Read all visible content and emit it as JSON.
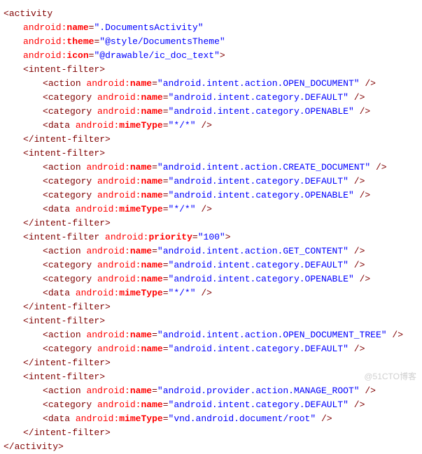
{
  "activity": {
    "name": ".DocumentsActivity",
    "theme": "@style/DocumentsTheme",
    "icon": "@drawable/ic_doc_text"
  },
  "filters": [
    {
      "priority": null,
      "actions": [
        "android.intent.action.OPEN_DOCUMENT"
      ],
      "categories": [
        "android.intent.category.DEFAULT",
        "android.intent.category.OPENABLE"
      ],
      "mimeType": "*/*"
    },
    {
      "priority": null,
      "actions": [
        "android.intent.action.CREATE_DOCUMENT"
      ],
      "categories": [
        "android.intent.category.DEFAULT",
        "android.intent.category.OPENABLE"
      ],
      "mimeType": "*/*"
    },
    {
      "priority": "100",
      "actions": [
        "android.intent.action.GET_CONTENT"
      ],
      "categories": [
        "android.intent.category.DEFAULT",
        "android.intent.category.OPENABLE"
      ],
      "mimeType": "*/*"
    },
    {
      "priority": null,
      "actions": [
        "android.intent.action.OPEN_DOCUMENT_TREE"
      ],
      "categories": [
        "android.intent.category.DEFAULT"
      ],
      "mimeType": null
    },
    {
      "priority": null,
      "actions": [
        "android.provider.action.MANAGE_ROOT"
      ],
      "categories": [
        "android.intent.category.DEFAULT"
      ],
      "mimeType": "vnd.android.document/root"
    }
  ],
  "tokens": {
    "activity_open": "activity",
    "activity_close": "activity",
    "intent_filter": "intent-filter",
    "action": "action",
    "category": "category",
    "data": "data",
    "attr_name": "name",
    "attr_theme": "theme",
    "attr_icon": "icon",
    "attr_mime": "mimeType",
    "attr_priority": "priority",
    "ns": "android:"
  },
  "watermark": "@51CTO博客"
}
